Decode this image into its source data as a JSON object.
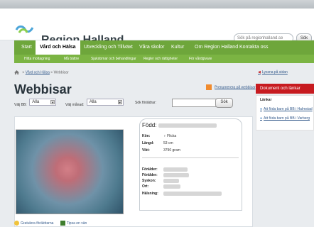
{
  "header": {
    "brand": "Region Halland",
    "search_placeholder": "Sök på regionhalland.se",
    "search_button": "Sök"
  },
  "nav": {
    "items": [
      "Start",
      "Vård och Hälsa",
      "Utveckling och Tillväxt",
      "Våra skolor",
      "Kultur",
      "Om Region Halland",
      "Kontakta oss"
    ],
    "subitems": [
      "Hitta mottagning",
      "Må bättre",
      "Sjukdomar och behandlingar",
      "Regler och rättigheter",
      "För vårdgivare"
    ]
  },
  "breadcrumb": {
    "home": "",
    "link": "Vård och Hälsa",
    "current": "Webbisar"
  },
  "page": {
    "title": "Webbisar",
    "subscribe": "Prenumerera på webbisar"
  },
  "filters": {
    "bb_label": "Välj BB:",
    "bb_value": "Alla",
    "month_label": "Välj månad:",
    "month_value": "Alla",
    "parents_label": "Sök föräldrar:",
    "search_button": "Sök"
  },
  "baby": {
    "birth_label": "Född:",
    "fields": {
      "kon_label": "Kön:",
      "kon_value": "Flicka",
      "langd_label": "Längd:",
      "langd_value": "53 cm",
      "vikt_label": "Vikt:",
      "vikt_value": "3790 gram",
      "foralder1_label": "Förälder:",
      "foralder2_label": "Förälder:",
      "syskon_label": "Syskon:",
      "ort_label": "Ort:",
      "halsning_label": "Hälsning:"
    }
  },
  "actions": {
    "congratulate": "Gratulera föräldrarna",
    "tip": "Tipsa en vän"
  },
  "sidebar": {
    "read_aloud": "Lyssna på sidan",
    "header": "Dokument och länkar",
    "links_label": "Länkar",
    "links": [
      "Att föda barn på BB i Halmstad",
      "Att föda barn på BB i Varberg"
    ]
  }
}
